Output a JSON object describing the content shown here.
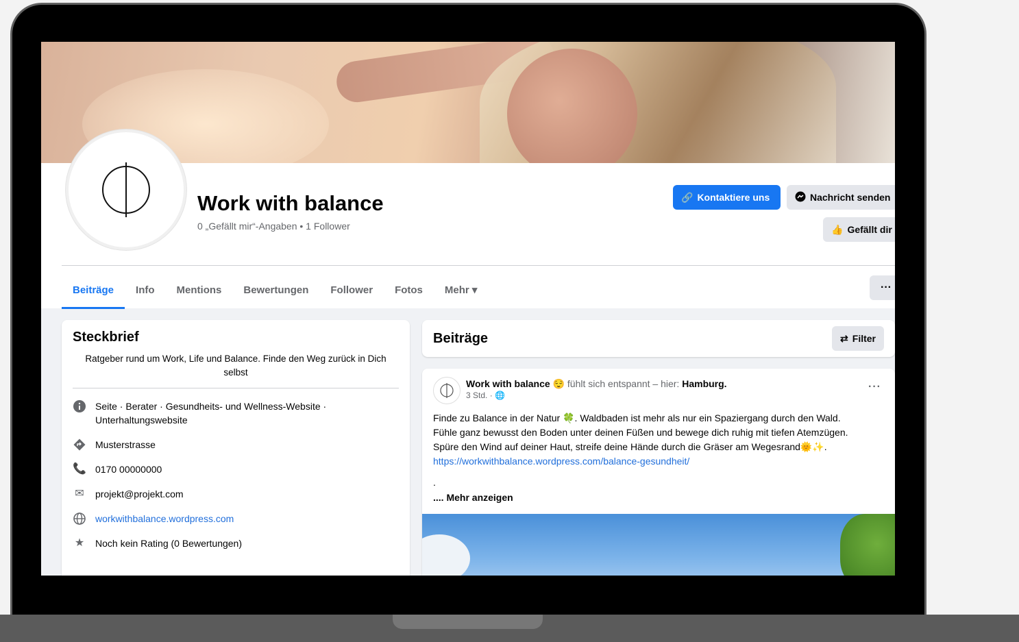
{
  "page": {
    "title": "Work with balance",
    "stats": "0 „Gefällt mir“-Angaben • 1 Follower"
  },
  "actions": {
    "contact": "Kontaktiere uns",
    "message": "Nachricht senden",
    "like": "Gefällt dir"
  },
  "tabs": [
    "Beiträge",
    "Info",
    "Mentions",
    "Bewertungen",
    "Follower",
    "Fotos",
    "Mehr ▾"
  ],
  "more_button": "···",
  "intro": {
    "title": "Steckbrief",
    "bio": "Ratgeber rund um Work, Life und Balance. Finde den Weg zurück in Dich selbst",
    "category": "Seite · Berater · Gesundheits- und Wellness-Website · Unterhaltungswebsite",
    "address": "Musterstrasse",
    "phone": "0170 00000000",
    "email": "projekt@projekt.com",
    "website": "workwithbalance.wordpress.com",
    "rating": "Noch kein Rating (0 Bewertungen)"
  },
  "posts": {
    "title": "Beiträge",
    "filter": "Filter"
  },
  "post": {
    "author": "Work with balance",
    "feeling": "fühlt sich entspannt – hier:",
    "location": "Hamburg.",
    "time": "3 Std. · 🌐",
    "line1": "Finde zu Balance in der Natur 🍀. Waldbaden ist mehr als nur ein Spaziergang durch den Wald.",
    "line2": "Fühle ganz bewusst den Boden unter deinen Füßen und bewege dich ruhig mit tiefen Atemzügen.",
    "line3": "Spüre den Wind auf deiner Haut, streife deine Hände durch die Gräser am Wegesrand🌞✨.",
    "link": "https://workwithbalance.wordpress.com/balance-gesundheit/",
    "dot": ".",
    "more": ".... Mehr anzeigen"
  },
  "colors": {
    "brand_blue": "#1877f2",
    "link_blue": "#216fdb"
  }
}
